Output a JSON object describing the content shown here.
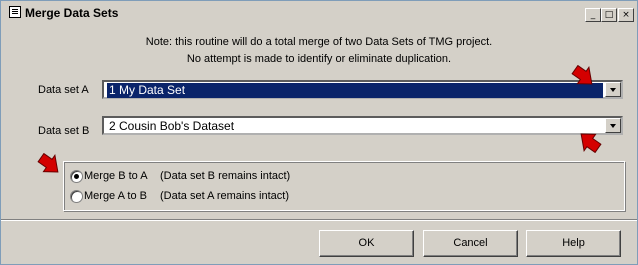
{
  "window": {
    "title": "Merge Data Sets",
    "controls": {
      "minimize": "_",
      "maximize": "□",
      "close": "×"
    }
  },
  "note": {
    "line1": "Note: this routine will do a total merge of two Data Sets of TMG project.",
    "line2": "No attempt is made to identify or eliminate duplication."
  },
  "dataset_a": {
    "label": "Data set A",
    "value": "1  My Data Set"
  },
  "dataset_b": {
    "label": "Data set B",
    "value": "2  Cousin Bob's Dataset"
  },
  "merge_options": [
    {
      "label": "Merge B to A",
      "description": "(Data set B remains intact)",
      "checked": true
    },
    {
      "label": "Merge A to B",
      "description": "(Data set A remains intact)",
      "checked": false
    }
  ],
  "buttons": {
    "ok": "OK",
    "cancel": "Cancel",
    "help": "Help"
  },
  "colors": {
    "accent_selected": "#0a246a",
    "arrow_red": "#d40000",
    "face": "#d4d0c8"
  }
}
